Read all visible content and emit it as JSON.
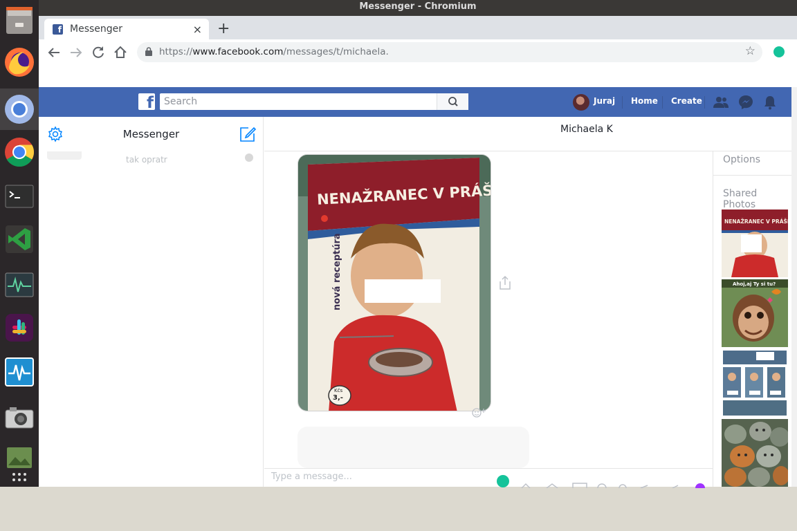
{
  "window": {
    "title": "Messenger - Chromium"
  },
  "tab": {
    "title": "Messenger",
    "close": "×",
    "new_tab": "+"
  },
  "omnibox": {
    "scheme": "https://",
    "host": "www.facebook.com",
    "path": "/messages/t/michaela."
  },
  "fb": {
    "logo": "f",
    "search_placeholder": "Search",
    "user_name": "Juraj",
    "nav_home": "Home",
    "nav_create": "Create"
  },
  "messenger": {
    "title": "Messenger",
    "conversation_snippet": "tak opratr",
    "chat_partner": "Michaela K",
    "composer_placeholder": "Type a message...",
    "info_options": "Options",
    "info_shared_photos": "Shared Photos"
  },
  "photo": {
    "product_title": "NENAŽRANEC V PRÁŠKU",
    "side_text": "nová receptúra",
    "price_label": "Kčs",
    "price_value": "3,-"
  },
  "thumbs": {
    "thumb2_caption": "Ahoj,aj Ty si tu?"
  },
  "colors": {
    "fb_blue": "#4267b2",
    "messenger_blue": "#0084ff",
    "dock_bg": "#2b2729"
  }
}
